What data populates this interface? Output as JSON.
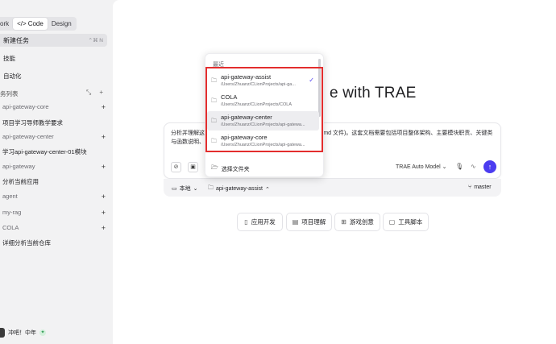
{
  "sidebar": {
    "modes": [
      "ork",
      "Code",
      "Design"
    ],
    "active_mode": "Code",
    "new_task_label": "新建任务",
    "new_task_shortcut": "⌃⌘ N",
    "nav": [
      "技能",
      "自动化"
    ],
    "task_list_title": "务列表",
    "groups": [
      {
        "name": "api-gateway-core",
        "tasks": [
          "项目学习导师教学要求"
        ]
      },
      {
        "name": "api-gateway-center",
        "tasks": [
          "学习api-gateway-center-01模块"
        ]
      },
      {
        "name": "api-gateway",
        "tasks": [
          "分析当前应用"
        ]
      },
      {
        "name": "agent",
        "tasks": []
      },
      {
        "name": "my-rag",
        "tasks": []
      },
      {
        "name": "COLA",
        "tasks": [
          "详细分析当前仓库"
        ]
      }
    ],
    "user_name": "冲吧！中年"
  },
  "hero": {
    "title_suffix": "e with TRAE"
  },
  "composer": {
    "text_part1": "分析并理解这个",
    "text_part2": "(md 文件)。这套文档需要包括项目整体架构、主要模块职责、关键类",
    "text_line2": "与函数说明、",
    "model": "TRAE Auto Model",
    "env_label": "本地",
    "repo_label": "api-gateway-assist",
    "branch_label": "master"
  },
  "quick_actions": [
    {
      "icon": "phone-icon",
      "label": "应用开发"
    },
    {
      "icon": "doc-icon",
      "label": "项目理解"
    },
    {
      "icon": "game-icon",
      "label": "游戏创意"
    },
    {
      "icon": "tool-icon",
      "label": "工具脚本"
    }
  ],
  "dropdown": {
    "section_label": "最近",
    "items": [
      {
        "name": "api-gateway-assist",
        "path": "/Users/Zhuanz/CLionProjects/api-ga...",
        "selected": true,
        "highlighted": false
      },
      {
        "name": "COLA",
        "path": "/Users/Zhuanz/CLionProjects/COLA",
        "selected": false,
        "highlighted": false
      },
      {
        "name": "api-gateway-center",
        "path": "/Users/Zhuanz/CLionProjects/api-gatewa...",
        "selected": false,
        "highlighted": true
      },
      {
        "name": "api-gateway-core",
        "path": "/Users/Zhuanz/CLionProjects/api-gatewa...",
        "selected": false,
        "highlighted": false
      }
    ],
    "choose_folder": "选择文件夹"
  },
  "colors": {
    "accent": "#4b3cf0",
    "highlight_border": "#e32d2d"
  }
}
